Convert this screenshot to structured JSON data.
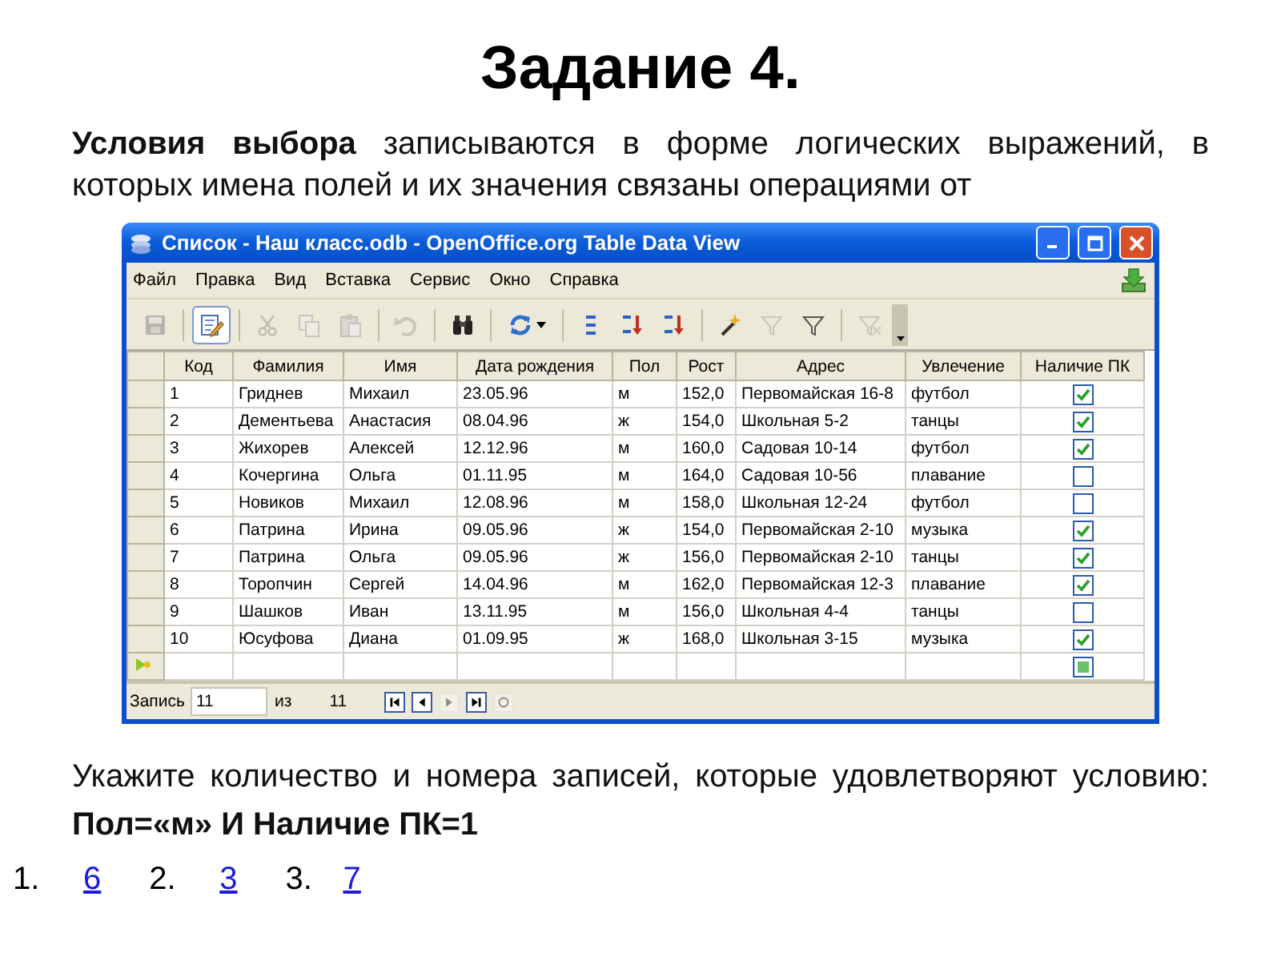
{
  "title": "Задание 4.",
  "intro": "**Условия выбора** записываются в форме логических выражений, в которых имена полей и их значения связаны операциями от",
  "window": {
    "title": "Список - Наш класс.odb - OpenOffice.org Table Data View",
    "menu": [
      "Файл",
      "Правка",
      "Вид",
      "Вставка",
      "Сервис",
      "Окно",
      "Справка"
    ],
    "toolbar": [
      {
        "kind": "save",
        "disabled": true,
        "selected": false
      },
      {
        "kind": "separator"
      },
      {
        "kind": "edit",
        "disabled": false,
        "selected": true
      },
      {
        "kind": "separator"
      },
      {
        "kind": "cut",
        "disabled": true,
        "selected": false
      },
      {
        "kind": "copy",
        "disabled": true,
        "selected": false
      },
      {
        "kind": "paste",
        "disabled": true,
        "selected": false
      },
      {
        "kind": "separator"
      },
      {
        "kind": "undo",
        "disabled": true,
        "selected": false
      },
      {
        "kind": "separator"
      },
      {
        "kind": "find",
        "disabled": false,
        "selected": false
      },
      {
        "kind": "separator"
      },
      {
        "kind": "refresh",
        "disabled": false,
        "selected": false
      },
      {
        "kind": "separator"
      },
      {
        "kind": "sort",
        "disabled": false,
        "selected": false
      },
      {
        "kind": "sort-asc",
        "disabled": false,
        "selected": false
      },
      {
        "kind": "sort-desc",
        "disabled": false,
        "selected": false
      },
      {
        "kind": "separator"
      },
      {
        "kind": "autofilter",
        "disabled": false,
        "selected": false
      },
      {
        "kind": "standard-filter",
        "disabled": true,
        "selected": false
      },
      {
        "kind": "filter",
        "disabled": false,
        "selected": false
      },
      {
        "kind": "separator"
      },
      {
        "kind": "remove-filter",
        "disabled": true,
        "selected": false
      }
    ],
    "columns": [
      "Код",
      "Фамилия",
      "Имя",
      "Дата рождения",
      "Пол",
      "Рост",
      "Адрес",
      "Увлечение",
      "Наличие ПК"
    ],
    "rows": [
      {
        "cells": [
          "1",
          "Гриднев",
          "Михаил",
          "23.05.96",
          "м",
          "152,0",
          "Первомайская 16-8",
          "футбол"
        ],
        "pc": true
      },
      {
        "cells": [
          "2",
          "Дементьева",
          "Анастасия",
          "08.04.96",
          "ж",
          "154,0",
          "Школьная 5-2",
          "танцы"
        ],
        "pc": true
      },
      {
        "cells": [
          "3",
          "Жихорев",
          "Алексей",
          "12.12.96",
          "м",
          "160,0",
          "Садовая 10-14",
          "футбол"
        ],
        "pc": true
      },
      {
        "cells": [
          "4",
          "Кочергина",
          "Ольга",
          "01.11.95",
          "м",
          "164,0",
          "Садовая 10-56",
          "плавание"
        ],
        "pc": false
      },
      {
        "cells": [
          "5",
          "Новиков",
          "Михаил",
          "12.08.96",
          "м",
          "158,0",
          "Школьная 12-24",
          "футбол"
        ],
        "pc": false
      },
      {
        "cells": [
          "6",
          "Патрина",
          "Ирина",
          "09.05.96",
          "ж",
          "154,0",
          "Первомайская 2-10",
          "музыка"
        ],
        "pc": true
      },
      {
        "cells": [
          "7",
          "Патрина",
          "Ольга",
          "09.05.96",
          "ж",
          "156,0",
          "Первомайская 2-10",
          "танцы"
        ],
        "pc": true
      },
      {
        "cells": [
          "8",
          "Торопчин",
          "Сергей",
          "14.04.96",
          "м",
          "162,0",
          "Первомайская 12-3",
          "плавание"
        ],
        "pc": true
      },
      {
        "cells": [
          "9",
          "Шашков",
          "Иван",
          "13.11.95",
          "м",
          "156,0",
          "Школьная 4-4",
          "танцы"
        ],
        "pc": false
      },
      {
        "cells": [
          "10",
          "Юсуфова",
          "Диана",
          "01.09.95",
          "ж",
          "168,0",
          "Школьная 3-15",
          "музыка"
        ],
        "pc": true
      }
    ],
    "new_row": {
      "pc_indeterminate": true
    },
    "status": {
      "record_label": "Запись",
      "record": "11",
      "of_label": "из",
      "total": "11",
      "nav": [
        {
          "kind": "first",
          "disabled": false
        },
        {
          "kind": "prev",
          "disabled": false
        },
        {
          "kind": "next",
          "disabled": true
        },
        {
          "kind": "last",
          "disabled": false
        },
        {
          "kind": "new",
          "disabled": true
        }
      ]
    }
  },
  "question": "Укажите количество и номера записей, которые удовлетворяют условию: **Пол=«м» И Наличие ПК=1**",
  "answers": [
    {
      "number": "1.",
      "value": "6"
    },
    {
      "number": "2.",
      "value": "3"
    },
    {
      "number": "3.",
      "value": "7"
    }
  ]
}
